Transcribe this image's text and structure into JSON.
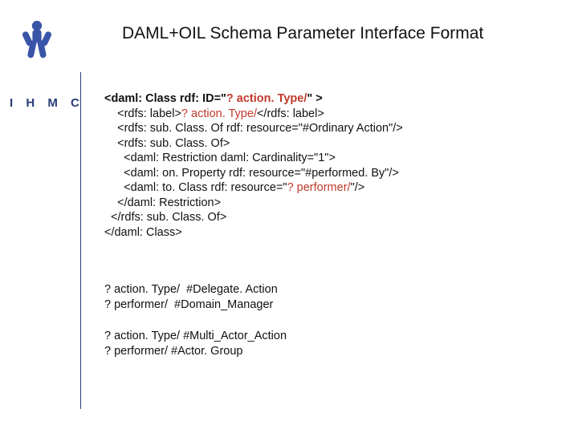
{
  "brand": "I H M C",
  "title": "DAML+OIL Schema Parameter Interface Format",
  "code": {
    "l1a": "<daml: Class rdf: ID=\"",
    "l1b": "? action. Type/",
    "l1c": "\" >",
    "l2a": "    <rdfs: label>",
    "l2b": "? action. Type/",
    "l2c": "</rdfs: label>",
    "l3": "    <rdfs: sub. Class. Of rdf: resource=\"#Ordinary Action\"/>",
    "l4": "    <rdfs: sub. Class. Of>",
    "l5": "      <daml: Restriction daml: Cardinality=\"1\">",
    "l6": "      <daml: on. Property rdf: resource=\"#performed. By\"/>",
    "l7a": "      <daml: to. Class rdf: resource=\"",
    "l7b": "? performer/",
    "l7c": "\"/>",
    "l8": "    </daml: Restriction>",
    "l9": "  </rdfs: sub. Class. Of>",
    "l10": "</daml: Class>"
  },
  "footer1": {
    "l1": "? action. Type/  #Delegate. Action",
    "l2": "? performer/  #Domain_Manager"
  },
  "footer2": {
    "l1": "? action. Type/ #Multi_Actor_Action",
    "l2": "? performer/ #Actor. Group"
  }
}
